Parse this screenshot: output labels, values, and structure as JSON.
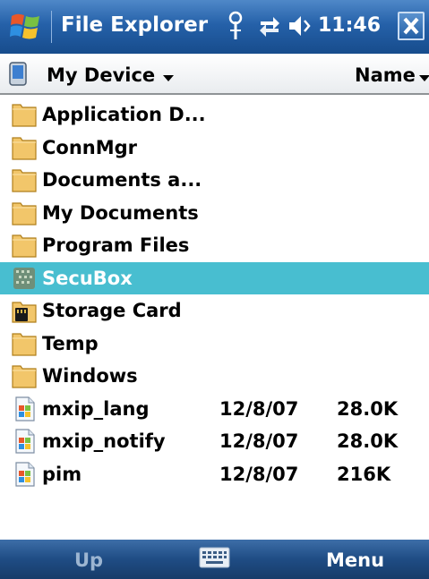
{
  "titlebar": {
    "title": "File Explorer",
    "time": "11:46",
    "icons": [
      "windows-start-icon",
      "signal-antenna-icon",
      "connectivity-icon",
      "speaker-volume-icon",
      "close-icon"
    ]
  },
  "header": {
    "location": "My Device",
    "sort": "Name",
    "icons": [
      "device-icon",
      "chevron-down-icon"
    ]
  },
  "files": [
    {
      "name": "Application D...",
      "type": "folder",
      "date": "",
      "size": "",
      "selected": false
    },
    {
      "name": "ConnMgr",
      "type": "folder",
      "date": "",
      "size": "",
      "selected": false
    },
    {
      "name": "Documents a...",
      "type": "folder",
      "date": "",
      "size": "",
      "selected": false
    },
    {
      "name": "My Documents",
      "type": "folder",
      "date": "",
      "size": "",
      "selected": false
    },
    {
      "name": "Program Files",
      "type": "folder",
      "date": "",
      "size": "",
      "selected": false
    },
    {
      "name": "SecuBox",
      "type": "secure-folder",
      "date": "",
      "size": "",
      "selected": true
    },
    {
      "name": "Storage Card",
      "type": "storage-card",
      "date": "",
      "size": "",
      "selected": false
    },
    {
      "name": "Temp",
      "type": "folder",
      "date": "",
      "size": "",
      "selected": false
    },
    {
      "name": "Windows",
      "type": "folder",
      "date": "",
      "size": "",
      "selected": false
    },
    {
      "name": "mxip_lang",
      "type": "file",
      "date": "12/8/07",
      "size": "28.0K",
      "selected": false
    },
    {
      "name": "mxip_notify",
      "type": "file",
      "date": "12/8/07",
      "size": "28.0K",
      "selected": false
    },
    {
      "name": "pim",
      "type": "file",
      "date": "12/8/07",
      "size": "216K",
      "selected": false
    }
  ],
  "softkeys": {
    "left": "Up",
    "right": "Menu",
    "center_icon": "keyboard-icon"
  },
  "colors": {
    "selection": "#48bed0",
    "titlebar": "#2561a9",
    "softbar": "#1f4c84",
    "folder": "#f2c66a"
  }
}
